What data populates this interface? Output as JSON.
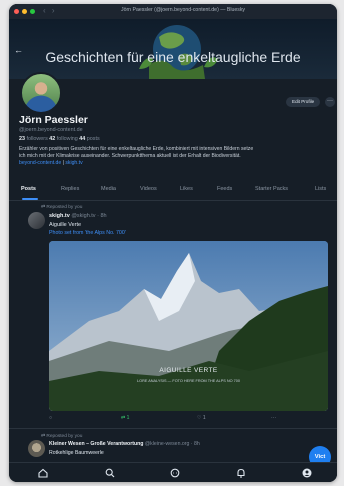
{
  "window": {
    "title": "Jörn Paessler (@joern.beyond-content.de) — Bluesky",
    "nav_arrows": "‹ ›",
    "traffic_lights": [
      "#ff5f57",
      "#febc2e",
      "#28c840"
    ]
  },
  "banner": {
    "title": "Geschichten für eine enkeltaugliche Erde",
    "back_icon": "back-arrow-icon"
  },
  "profile": {
    "name": "Jörn Paessler",
    "handle": "@joern.beyond-content.de",
    "followers_count": "23",
    "followers_label": "followers",
    "following_count": "42",
    "following_label": "following",
    "posts_count": "44",
    "posts_label": "posts",
    "bio_line1": "Erzähler von positiven Geschichten für eine enkeltaugliche Erde, kombiniert mit intensiven Bildern setze",
    "bio_line2": "ich mich mit der Klimakrise auseinander. Schwerpunktthema aktuell ist der Erhalt der Biodiversität.",
    "bio_link1": "beyond-content.de",
    "bio_link_sep": "|",
    "bio_link2": "skigh.tv",
    "edit_button": "Edit Profile",
    "more_button": "···"
  },
  "tabs": [
    "Posts",
    "Replies",
    "Media",
    "Videos",
    "Likes",
    "Feeds",
    "Starter Packs",
    "Lists"
  ],
  "active_tab": "Posts",
  "post1": {
    "repost_label": "Reposted by you",
    "author": "skigh.tv",
    "author_handle": "@skigh.tv · 8h",
    "text": "Aiguille Verte",
    "subtext": "Photo set from 'the Alps No. 700'",
    "image_caption": "AIGUILLE VERTE",
    "image_sub": "LORE ANALYSIS — FOTO HERE FROM THE ALPS NO 700",
    "reply_count": "",
    "repost_count": "1",
    "like_count": "1",
    "more_label": "···"
  },
  "post2": {
    "repost_label": "Reposted by you",
    "author": "Kleiner Wesen – Große Verantwortung",
    "author_handle": "@kleine-wesen.org · 8h",
    "text": "Rotkehlige Baumweerle"
  },
  "fab_label": "Vict",
  "bottom_nav": [
    "home-icon",
    "search-icon",
    "chat-icon",
    "bell-icon",
    "profile-icon"
  ],
  "colors": {
    "accent": "#3e8ef6",
    "repost_green": "#35c46b",
    "background": "#161e27"
  }
}
